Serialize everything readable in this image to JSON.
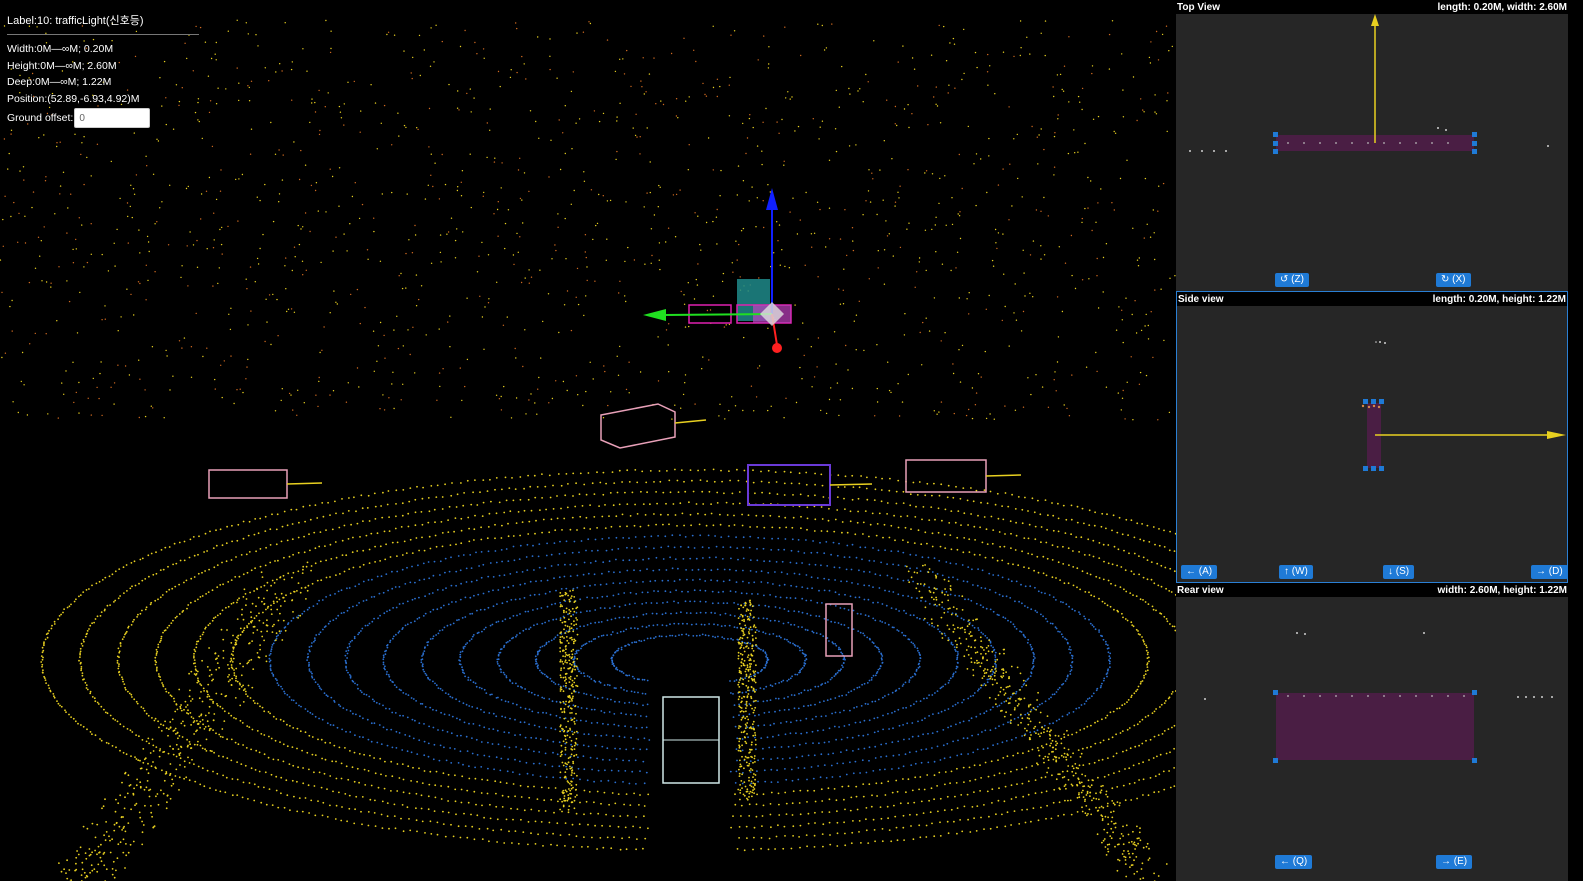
{
  "info": {
    "title": "Label:10: trafficLight(신호등)",
    "width": "Width:0M—∞M; 0.20M",
    "height": "Height:0M—∞M; 2.60M",
    "deep": "Deep:0M—∞M; 1.22M",
    "position": "Position:(52.89,-6.93,4.92)M",
    "ground_offset_label": "Ground offset:",
    "ground_offset_value": "0"
  },
  "top_view": {
    "title": "Top View",
    "dims": "length: 0.20M, width: 2.60M",
    "rotate_left": "↺ (Z)",
    "rotate_right": "↻ (X)"
  },
  "side_view": {
    "title": "Side view",
    "dims": "length: 0.20M, height: 1.22M",
    "left": "← (A)",
    "up": "↑ (W)",
    "down": "↓ (S)",
    "right": "→ (D)"
  },
  "rear_view": {
    "title": "Rear view",
    "dims": "width: 2.60M, height: 1.22M",
    "left": "← (Q)",
    "right": "→ (E)"
  },
  "colors": {
    "point_near": "#2a6fd0",
    "point_mid": "#e8d020",
    "point_far": "#d06a20",
    "box_selected": "#4a1e44",
    "handle": "#1f7ad6"
  }
}
